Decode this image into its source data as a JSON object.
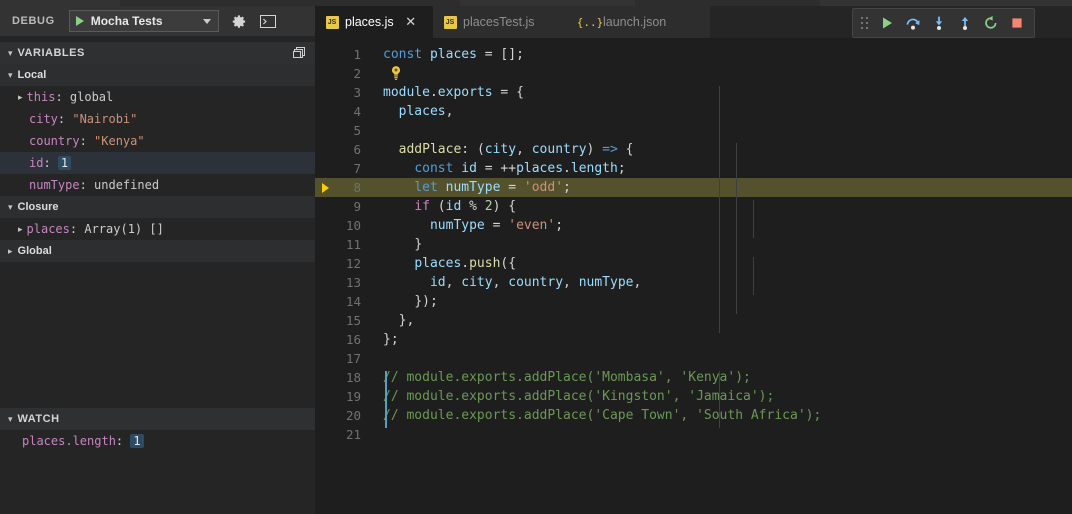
{
  "window": {
    "theme_bg": "#1e1e1e",
    "accent": "#e8c84a"
  },
  "sidebar": {
    "bar": {
      "title": "DEBUG",
      "launch_config": "Mocha Tests",
      "start_icon": "play-icon",
      "dropdown_icon": "chevron-down-icon",
      "settings_icon": "gear-icon",
      "console_icon": "open-debug-console-icon"
    },
    "variables_section": {
      "label": "VARIABLES",
      "twisty": "▾",
      "action_icon": "collapse-all-icon"
    },
    "scopes": [
      {
        "name": "Local",
        "twisty": "▾",
        "expanded": true,
        "rows": [
          {
            "twisty": "▸",
            "expandable": true,
            "name": "this",
            "value": "global",
            "value_kind": "plain",
            "selected": false
          },
          {
            "twisty": "",
            "expandable": false,
            "name": "city",
            "value": "\"Nairobi\"",
            "value_kind": "string",
            "selected": false
          },
          {
            "twisty": "",
            "expandable": false,
            "name": "country",
            "value": "\"Kenya\"",
            "value_kind": "string",
            "selected": false
          },
          {
            "twisty": "",
            "expandable": false,
            "name": "id",
            "value": "1",
            "value_kind": "number",
            "selected": true
          },
          {
            "twisty": "",
            "expandable": false,
            "name": "numType",
            "value": "undefined",
            "value_kind": "plain",
            "selected": false
          }
        ]
      },
      {
        "name": "Closure",
        "twisty": "▾",
        "expanded": true,
        "rows": [
          {
            "twisty": "▸",
            "expandable": true,
            "name": "places",
            "value": "Array(1) []",
            "value_kind": "plain",
            "selected": false
          }
        ]
      },
      {
        "name": "Global",
        "twisty": "▸",
        "expanded": false,
        "rows": []
      }
    ],
    "watch_section": {
      "label": "WATCH",
      "twisty": "▾",
      "rows": [
        {
          "name": "places.length",
          "value": "1",
          "value_kind": "number"
        }
      ]
    }
  },
  "editor": {
    "tabs": [
      {
        "name": "places.js",
        "icon": "js-file-icon",
        "icon_text": "JS",
        "active": true,
        "close_glyph": "✕",
        "dirty": false
      },
      {
        "name": "placesTest.js",
        "icon": "js-file-icon",
        "icon_text": "JS",
        "active": false,
        "close_glyph": "",
        "dirty": false
      },
      {
        "name": "launch.json",
        "icon": "json-file-icon",
        "icon_text": "{..}",
        "active": false,
        "close_glyph": "",
        "dirty": false
      }
    ],
    "debug_toolbar": {
      "grip": "drag-handle-icon",
      "buttons": [
        {
          "name": "continue-button",
          "icon": "play-icon",
          "color": "#89d185"
        },
        {
          "name": "step-over-button",
          "icon": "step-over-icon",
          "color": "#75beff"
        },
        {
          "name": "step-into-button",
          "icon": "step-into-icon",
          "color": "#75beff"
        },
        {
          "name": "step-out-button",
          "icon": "step-out-icon",
          "color": "#75beff"
        },
        {
          "name": "restart-button",
          "icon": "restart-icon",
          "color": "#89d185"
        },
        {
          "name": "stop-button",
          "icon": "stop-icon",
          "color": "#f48771"
        }
      ]
    },
    "current_line": 8,
    "execution_pointer_icon": "debug-current-arrow-icon",
    "lightbulb_line": 2,
    "lightbulb_icon": "lightbulb-icon",
    "lines": [
      {
        "no": "1",
        "text": "const places = [];"
      },
      {
        "no": "2",
        "text": ""
      },
      {
        "no": "3",
        "text": "module.exports = {"
      },
      {
        "no": "4",
        "text": "  places,"
      },
      {
        "no": "5",
        "text": ""
      },
      {
        "no": "6",
        "text": "  addPlace: (city, country) => {"
      },
      {
        "no": "7",
        "text": "    const id = ++places.length;"
      },
      {
        "no": "8",
        "text": "    let numType = 'odd';"
      },
      {
        "no": "9",
        "text": "    if (id % 2) {"
      },
      {
        "no": "10",
        "text": "      numType = 'even';"
      },
      {
        "no": "11",
        "text": "    }"
      },
      {
        "no": "12",
        "text": "    places.push({"
      },
      {
        "no": "13",
        "text": "      id, city, country, numType,"
      },
      {
        "no": "14",
        "text": "    });"
      },
      {
        "no": "15",
        "text": "  },"
      },
      {
        "no": "16",
        "text": "};"
      },
      {
        "no": "17",
        "text": ""
      },
      {
        "no": "18",
        "text": "// module.exports.addPlace('Mombasa', 'Kenya');"
      },
      {
        "no": "19",
        "text": "// module.exports.addPlace('Kingston', 'Jamaica');"
      },
      {
        "no": "20",
        "text": "// module.exports.addPlace('Cape Town', 'South Africa');"
      },
      {
        "no": "21",
        "text": ""
      }
    ]
  }
}
